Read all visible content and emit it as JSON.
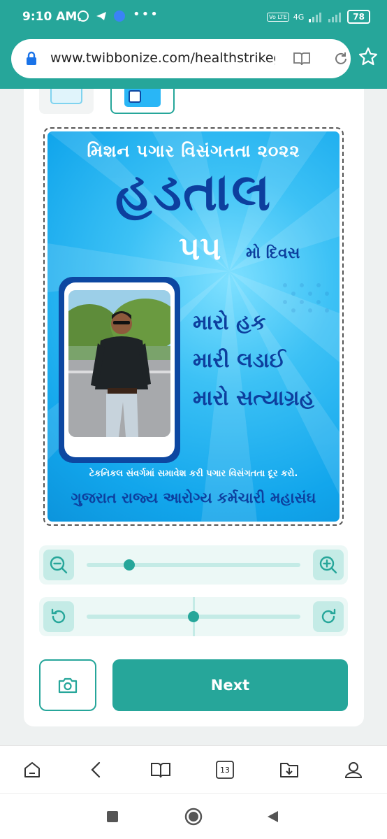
{
  "status_bar": {
    "time": "9:10 AM",
    "dots": "•••",
    "network": "4G",
    "volte": "Vo LTE",
    "battery": "78"
  },
  "browser": {
    "url": "www.twibbonize.com/healthstrikeg",
    "tab_count": "13"
  },
  "poster": {
    "title_top": "મિશન પગાર વિસંગતતા ૨૦૨૨",
    "title_main": "હડતાલ",
    "day_number": "૫૫",
    "day_suffix": "મો દિવસ",
    "slogans": [
      "મારો હક",
      "મારી લડાઈ",
      "મારો સત્યાગ્રહ"
    ],
    "footer_line": "ટેકનિકલ સંવર્ગમાં સમાવેશ કરી પગાર વિસંગતતા દૂર કરો.",
    "footer_org": "ગુજરાત રાજ્ય આરોગ્ય કર્મચારી મહાસંઘ",
    "colors": {
      "dark_blue": "#0d3f9e",
      "sky": "#29b6f6"
    }
  },
  "controls": {
    "zoom_level": 0.2,
    "rotation_level": 0.5,
    "next_label": "Next"
  },
  "theme": {
    "accent": "#26a69a",
    "accent_light": "#c4ebe6"
  }
}
